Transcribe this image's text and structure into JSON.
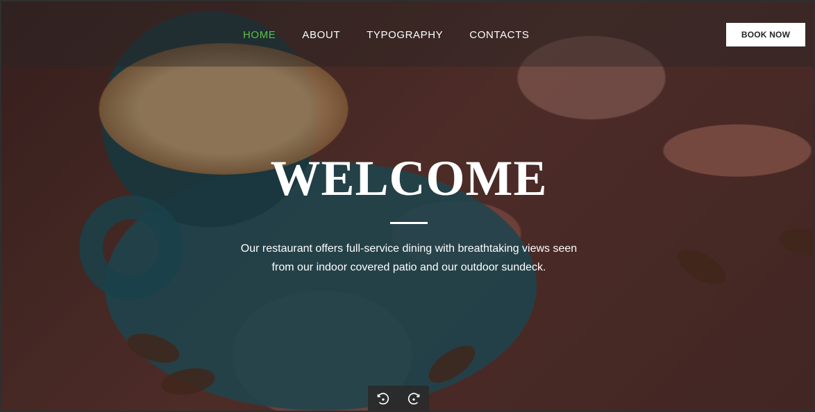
{
  "navigation": {
    "items": [
      {
        "label": "HOME",
        "active": true
      },
      {
        "label": "ABOUT",
        "active": false
      },
      {
        "label": "TYPOGRAPHY",
        "active": false
      },
      {
        "label": "CONTACTS",
        "active": false
      }
    ],
    "active_color": "#5fbf41"
  },
  "header": {
    "book_button_label": "BOOK NOW"
  },
  "hero": {
    "title": "WELCOME",
    "description": "Our restaurant offers full-service dining with breathtaking views seen from our indoor covered patio and our outdoor sundeck."
  },
  "media_controls": {
    "left_icon": "rotate-left-icon",
    "right_icon": "rotate-right-icon"
  },
  "colors": {
    "nav_text": "#ffffff",
    "button_background": "#ffffff",
    "button_text": "#252525",
    "hero_text": "#ffffff"
  }
}
